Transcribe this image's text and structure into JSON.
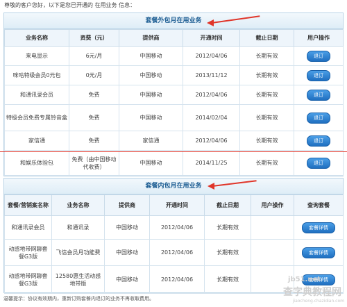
{
  "intro": "尊敬的客户您好，以下是您已开通的 在用业务 信息：",
  "section1": {
    "title": "套餐外包月在用业务",
    "headers": [
      "业务名称",
      "资费（元）",
      "提供商",
      "开通时间",
      "截止日期",
      "用户操作"
    ],
    "rows": [
      [
        "来电显示",
        "6元/月",
        "中国移动",
        "2012/04/06",
        "长期有效",
        "退订"
      ],
      [
        "咪咕特级会员0元包",
        "0元/月",
        "中国移动",
        "2013/11/12",
        "长期有效",
        "退订"
      ],
      [
        "和通讯录会员",
        "免费",
        "中国移动",
        "2012/04/06",
        "长期有效",
        "退订"
      ],
      [
        "特级会员免费专属铃音盒",
        "免费",
        "中国移动",
        "2014/02/04",
        "长期有效",
        "退订"
      ],
      [
        "家信通",
        "免费",
        "家信通",
        "2012/04/06",
        "长期有效",
        "退订"
      ],
      [
        "和娱乐体验包",
        "免费（由中国移动代收费）",
        "中国移动",
        "2014/11/25",
        "长期有效",
        "退订"
      ]
    ]
  },
  "section2": {
    "title": "套餐内包月在用业务",
    "headers": [
      "套餐/营销案名称",
      "业务名称",
      "提供商",
      "开通时间",
      "截止日期",
      "用户操作",
      "查询套餐"
    ],
    "rows": [
      [
        "和通讯录会员",
        "和通讯录",
        "中国移动",
        "2012/04/06",
        "长期有效",
        "",
        "套餐详情"
      ],
      [
        "动感地带网聊套餐G3版",
        "飞信会员月功能费",
        "中国移动",
        "2012/04/06",
        "长期有效",
        "",
        "套餐详情"
      ],
      [
        "动感地带网聊套餐G3版",
        "12580惠生活动感地带版",
        "中国移动",
        "2012/04/06",
        "长期有效",
        "",
        "套餐详情"
      ]
    ]
  },
  "footer": "温馨提示：协议有效期内，重新订购套餐内退订的业务不再收取费用。",
  "watermark": {
    "line1": "查字典",
    "line2": "教程网",
    "line3": "jiaocheng.chazidian.com",
    "site": "jb51.net"
  },
  "colors": {
    "accent": "#1f6fc0",
    "arrow": "#e0362a",
    "header_text": "#1f5f94"
  }
}
